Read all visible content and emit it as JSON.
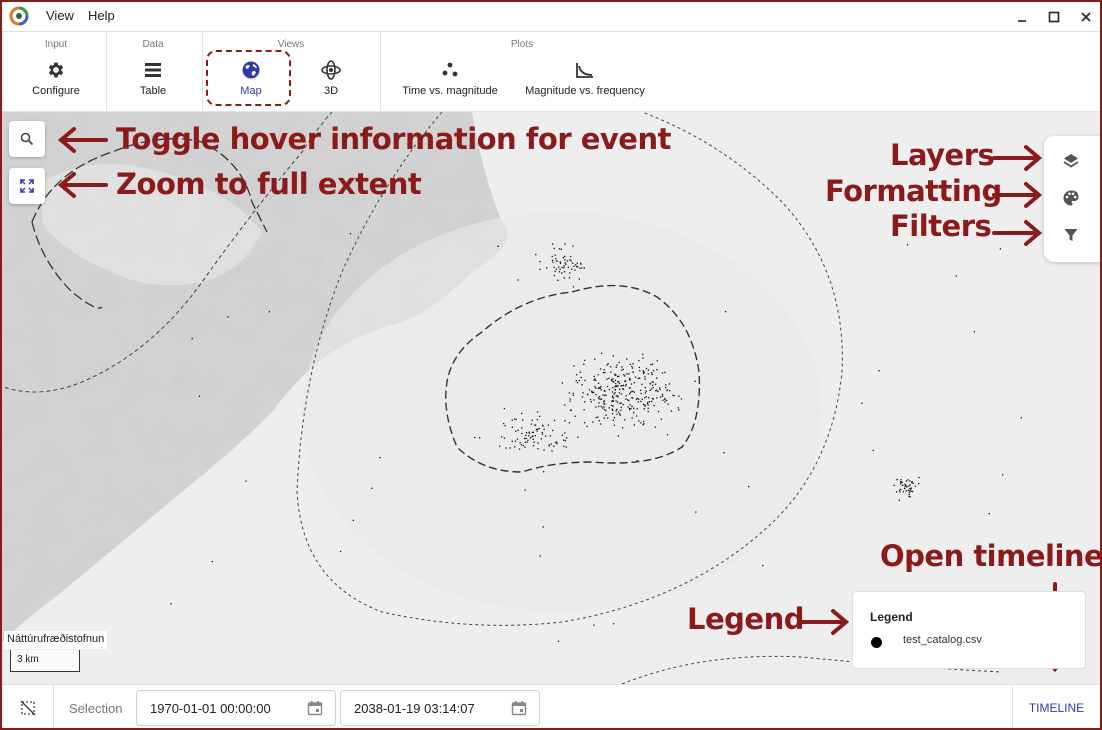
{
  "menu": {
    "view": "View",
    "help": "Help"
  },
  "ribbon": {
    "groups": {
      "input": "Input",
      "data": "Data",
      "views": "Views",
      "plots": "Plots"
    },
    "tools": {
      "configure": "Configure",
      "table": "Table",
      "map": "Map",
      "three_d": "3D",
      "time_vs_magnitude": "Time vs. magnitude",
      "magnitude_vs_frequency": "Magnitude vs. frequency"
    },
    "active_tool": "Map"
  },
  "annotations": {
    "hover": "Toggle hover information for event",
    "zoom": "Zoom to full extent",
    "layers": "Layers",
    "formatting": "Formatting",
    "filters": "Filters",
    "timeline": "Open timeline",
    "legend": "Legend"
  },
  "legend": {
    "title": "Legend",
    "items": [
      {
        "label": "test_catalog.csv",
        "color": "#000000"
      }
    ]
  },
  "map": {
    "attribution": "Náttúrufræðistofnun",
    "scale": "3 km"
  },
  "bottom": {
    "selection_label": "Selection",
    "start_date": "1970-01-01 00:00:00",
    "end_date": "2038-01-19 03:14:07",
    "timeline": "TIMELINE"
  },
  "colors": {
    "accent": "#2e3aa8",
    "annotation": "#8b1a1a"
  }
}
